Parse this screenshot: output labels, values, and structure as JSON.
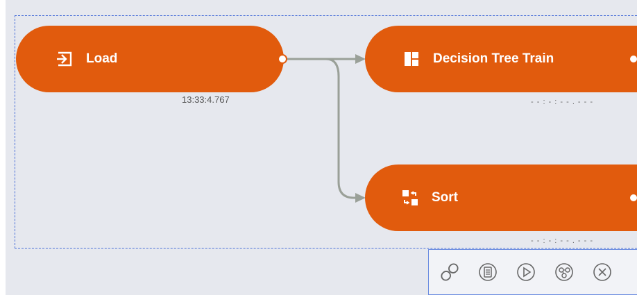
{
  "nodes": {
    "load": {
      "label": "Load",
      "timestamp": "13:33:4.767"
    },
    "decision_tree_train": {
      "label": "Decision Tree Train",
      "timestamp": "- - : - : - - . - - -"
    },
    "sort": {
      "label": "Sort",
      "timestamp": "- - : - : - - . - - -"
    }
  },
  "toolbar": {
    "tools": [
      "link-icon",
      "clipboard-icon",
      "play-icon",
      "workflow-icon",
      "close-icon"
    ]
  },
  "colors": {
    "node": "#e15b0d",
    "canvas": "#e6e8ee",
    "link": "#9aa098",
    "selection": "#4a6fd8"
  }
}
